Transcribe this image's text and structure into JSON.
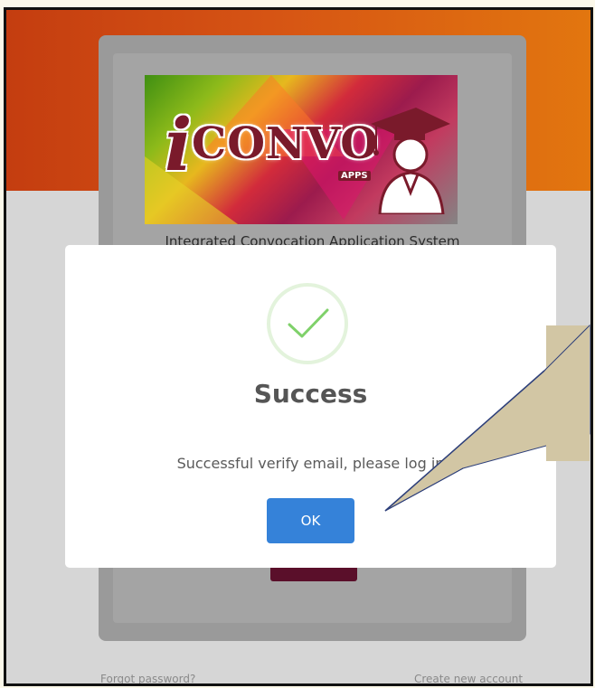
{
  "background_page": {
    "logo": {
      "i_letter": "i",
      "word": "CONVO",
      "sub": "APPS"
    },
    "tagline": "Integrated Convocation Application System",
    "links": {
      "forgot_password": "Forgot password?",
      "create_account": "Create new account"
    }
  },
  "modal": {
    "icon": "checkmark-icon",
    "title": "Success",
    "message": "Successful verify email, please log in",
    "ok_label": "OK"
  },
  "colors": {
    "band": "#d65414",
    "ok_button": "#3582d9",
    "check": "#7fd16a",
    "callout_fill": "#d2c6a4",
    "callout_stroke": "#2d3f7a"
  }
}
